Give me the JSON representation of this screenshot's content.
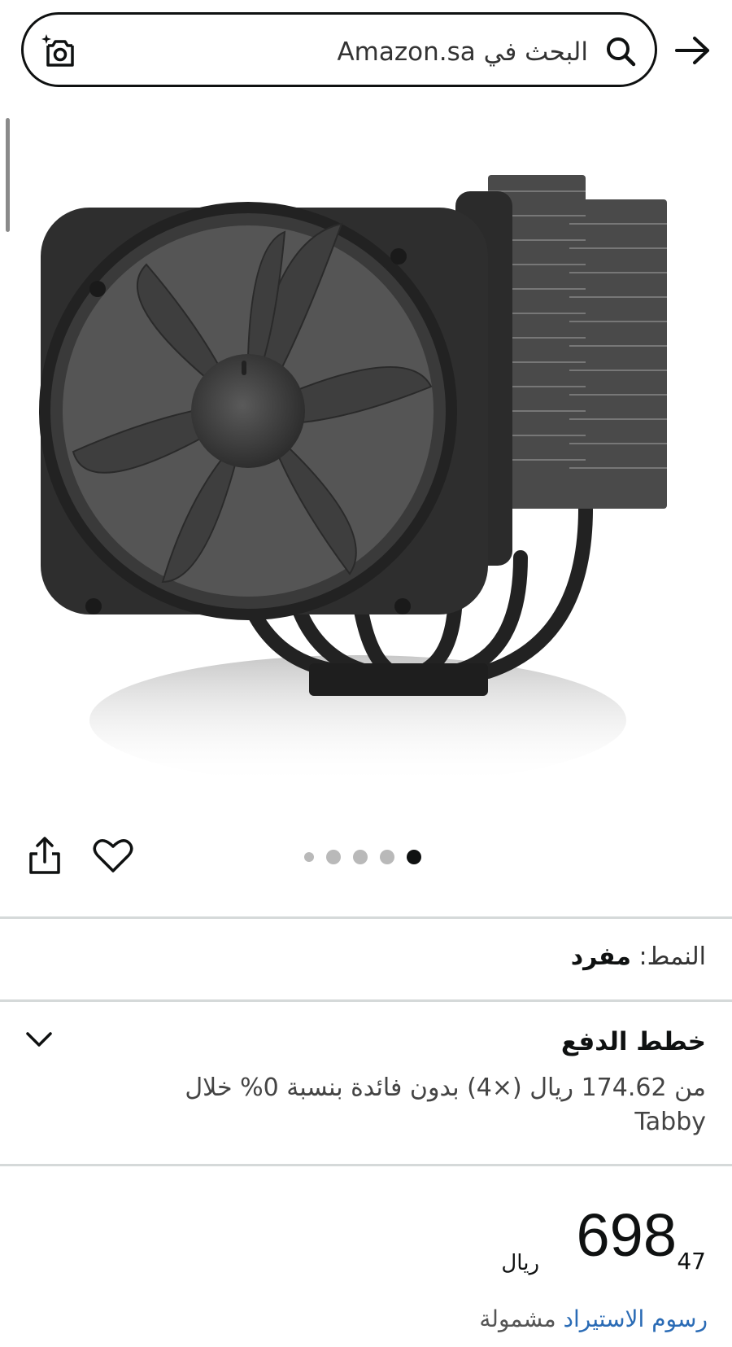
{
  "header": {
    "search_text": "البحث في Amazon.sa"
  },
  "gallery": {
    "image_alt": "",
    "dots_count": 5,
    "active_dot": 5
  },
  "style": {
    "label": "النمط:",
    "value": "مفرد"
  },
  "payment_plans": {
    "title": "خطط الدفع",
    "description": "من 174.62 ريال (×4) بدون فائدة بنسبة 0% خلال Tabby"
  },
  "price": {
    "whole": "698",
    "fraction": "47",
    "currency": "ريال"
  },
  "import_fees": {
    "link": "رسوم الاستيراد",
    "included": "مشمولة"
  },
  "colors": {
    "link": "#2a6bb5",
    "text": "#0f1111",
    "divider": "#d5d9d9"
  }
}
